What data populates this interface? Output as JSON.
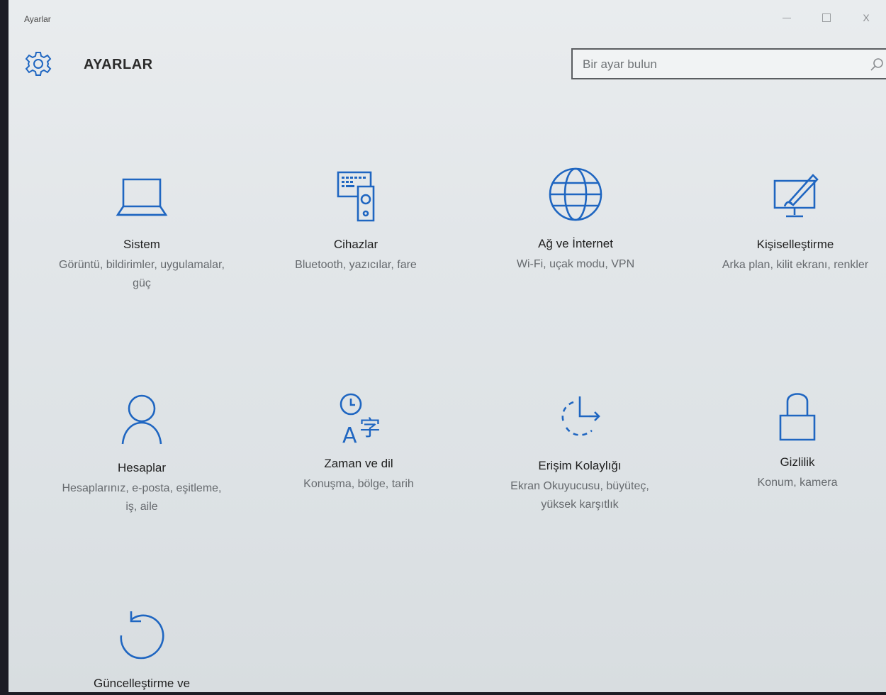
{
  "window": {
    "title": "Ayarlar",
    "controls": [
      "minimize",
      "maximize",
      "close"
    ],
    "close_glyph": "X"
  },
  "header": {
    "app_title": "AYARLAR",
    "search_placeholder": "Bir ayar bulun",
    "icon": "gear-icon"
  },
  "accent_color": "#1f66c1",
  "categories": [
    {
      "icon": "laptop-icon",
      "title": "Sistem",
      "description": "Görüntü, bildirimler, uygulamalar, güç"
    },
    {
      "icon": "devices-icon",
      "title": "Cihazlar",
      "description": "Bluetooth, yazıcılar, fare"
    },
    {
      "icon": "globe-icon",
      "title": "Ağ ve İnternet",
      "description": "Wi-Fi, uçak modu, VPN"
    },
    {
      "icon": "personalization-icon",
      "title": "Kişiselleştirme",
      "description": "Arka plan, kilit ekranı, renkler"
    },
    {
      "icon": "person-icon",
      "title": "Hesaplar",
      "description": "Hesaplarınız, e-posta, eşitleme, iş, aile"
    },
    {
      "icon": "time-language-icon",
      "title": "Zaman ve dil",
      "description": "Konuşma, bölge, tarih"
    },
    {
      "icon": "ease-of-access-icon",
      "title": "Erişim Kolaylığı",
      "description": "Ekran Okuyucusu, büyüteç, yüksek karşıtlık"
    },
    {
      "icon": "lock-icon",
      "title": "Gizlilik",
      "description": "Konum, kamera"
    },
    {
      "icon": "update-icon",
      "title": "Güncelleştirme ve",
      "description": ""
    }
  ]
}
